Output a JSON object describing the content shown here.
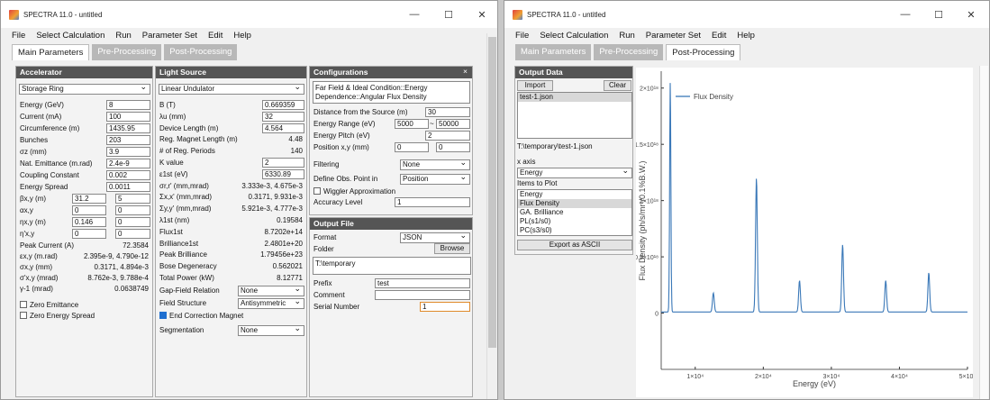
{
  "window_title": "SPECTRA 11.0 - untitled",
  "menus": [
    "File",
    "Select Calculation",
    "Run",
    "Parameter Set",
    "Edit",
    "Help"
  ],
  "tabs": [
    "Main Parameters",
    "Pre-Processing",
    "Post-Processing"
  ],
  "accelerator": {
    "title": "Accelerator",
    "type": "Storage Ring",
    "energy_label": "Energy (GeV)",
    "energy": "8",
    "current_label": "Current (mA)",
    "current": "100",
    "circ_label": "Circumference (m)",
    "circ": "1435.95",
    "bunches_label": "Bunches",
    "bunches": "203",
    "sigz_label": "σz (mm)",
    "sigz": "3.9",
    "emit_label": "Nat. Emittance (m.rad)",
    "emit": "2.4e-9",
    "coup_label": "Coupling Constant",
    "coup": "0.002",
    "espread_label": "Energy Spread",
    "espread": "0.0011",
    "beta_label": "βx,y (m)",
    "beta_x": "31.2",
    "beta_y": "5",
    "alpha_label": "αx,y",
    "alpha_x": "0",
    "alpha_y": "0",
    "eta_label": "ηx,y (m)",
    "eta_x": "0.146",
    "eta_y": "0",
    "etap_label": "η'x,y",
    "etap_x": "0",
    "etap_y": "0",
    "peak_label": "Peak Current (A)",
    "peak": "72.3584",
    "epsxy_label": "εx,y (m.rad)",
    "epsxy": "2.395e-9,  4.790e-12",
    "sigxy_label": "σx,y (mm)",
    "sigxy": "0.3171,  4.894e-3",
    "sigpxy_label": "σ'x,y (mrad)",
    "sigpxy": "8.762e-3,  9.788e-4",
    "gam_label": "γ-1 (mrad)",
    "gam": "0.0638749",
    "zero_emit": "Zero Emittance",
    "zero_es": "Zero Energy Spread"
  },
  "light_source": {
    "title": "Light Source",
    "type": "Linear Undulator",
    "rows": [
      {
        "l": "B (T)",
        "v": "0.669359",
        "kind": "input"
      },
      {
        "l": "λu (mm)",
        "v": "32",
        "kind": "input"
      },
      {
        "l": "Device Length (m)",
        "v": "4.564",
        "kind": "input"
      },
      {
        "l": "Reg. Magnet Length (m)",
        "v": "4.48",
        "kind": "text"
      },
      {
        "l": "# of Reg. Periods",
        "v": "140",
        "kind": "text"
      },
      {
        "l": "K value",
        "v": "2",
        "kind": "input"
      },
      {
        "l": "ε1st (eV)",
        "v": "6330.89",
        "kind": "input"
      },
      {
        "l": "σr,r' (mm,mrad)",
        "v": "3.333e-3,   4.675e-3",
        "kind": "text"
      },
      {
        "l": "Σx,x' (mm,mrad)",
        "v": "0.3171,   9.931e-3",
        "kind": "text"
      },
      {
        "l": "Σy,y' (mm,mrad)",
        "v": "5.921e-3,   4.777e-3",
        "kind": "text"
      },
      {
        "l": "λ1st (nm)",
        "v": "0.19584",
        "kind": "text"
      },
      {
        "l": "Flux1st",
        "v": "8.7202e+14",
        "kind": "text"
      },
      {
        "l": "Brilliance1st",
        "v": "2.4801e+20",
        "kind": "text"
      },
      {
        "l": "Peak Brilliance",
        "v": "1.79456e+23",
        "kind": "text"
      },
      {
        "l": "Bose Degeneracy",
        "v": "0.562021",
        "kind": "text"
      },
      {
        "l": "Total Power (kW)",
        "v": "8.12771",
        "kind": "text"
      }
    ],
    "gap_label": "Gap-Field Relation",
    "gap": "None",
    "field_label": "Field Structure",
    "field": "Antisymmetric",
    "endmag": "End Correction Magnet",
    "seg_label": "Segmentation",
    "seg": "None"
  },
  "config": {
    "title": "Configurations",
    "close": "×",
    "calc": "Far Field & Ideal Condition::Energy Dependence::Angular Flux Density",
    "dist_label": "Distance from the Source (m)",
    "dist": "30",
    "erange_label": "Energy Range (eV)",
    "emin": "5000",
    "tilde": "~",
    "emax": "50000",
    "epitch_label": "Energy Pitch (eV)",
    "epitch": "2",
    "pos_label": "Position x,y (mm)",
    "pos_x": "0",
    "pos_y": "0",
    "filter_label": "Filtering",
    "filter": "None",
    "obs_label": "Define Obs. Point in",
    "obs": "Position",
    "wiggler": "Wiggler Approximation",
    "acc_label": "Accuracy Level",
    "acc": "1"
  },
  "output": {
    "title": "Output File",
    "format_label": "Format",
    "format": "JSON",
    "folder_label": "Folder",
    "browse": "Browse",
    "folder": "T:\\temporary",
    "prefix_label": "Prefix",
    "prefix": "test",
    "comment_label": "Comment",
    "serial_label": "Serial Number",
    "serial": "1"
  },
  "post": {
    "title": "Output Data",
    "import": "Import",
    "clear": "Clear",
    "files": [
      "test-1.json"
    ],
    "path": "T:\\temporary\\test-1.json",
    "xaxis_label": "x axis",
    "xaxis": "Energy",
    "items_label": "Items to Plot",
    "items": [
      "Energy",
      "Flux Density",
      "GA. Brilliance",
      "PL(s1/s0)",
      "PC(s3/s0)"
    ],
    "selected_item": "Flux Density",
    "export": "Export as ASCII"
  },
  "chart_data": {
    "type": "line",
    "xlabel": "Energy (eV)",
    "ylabel": "Flux Density (ph/s/mr²/0.1%B.W.)",
    "xlim": [
      5000,
      50000
    ],
    "ylim": [
      -5e+17,
      2.15e+18
    ],
    "x_ticks": [
      "1×10⁴",
      "2×10⁴",
      "3×10⁴",
      "4×10⁴",
      "5×10⁴"
    ],
    "y_ticks": [
      "0",
      "0.5×10¹⁸",
      "1×10¹⁸",
      "1.5×10¹⁸",
      "2×10¹⁸"
    ],
    "series": [
      {
        "name": "Flux Density",
        "color": "#3a78b8",
        "peaks": [
          [
            6331,
            2.05e+18
          ],
          [
            12662,
            1.7e+17
          ],
          [
            18993,
            1.19e+18
          ],
          [
            25324,
            2.8e+17
          ],
          [
            31655,
            6e+17
          ],
          [
            37986,
            2.8e+17
          ],
          [
            44317,
            3.5e+17
          ]
        ]
      }
    ],
    "legend": "top-left"
  }
}
